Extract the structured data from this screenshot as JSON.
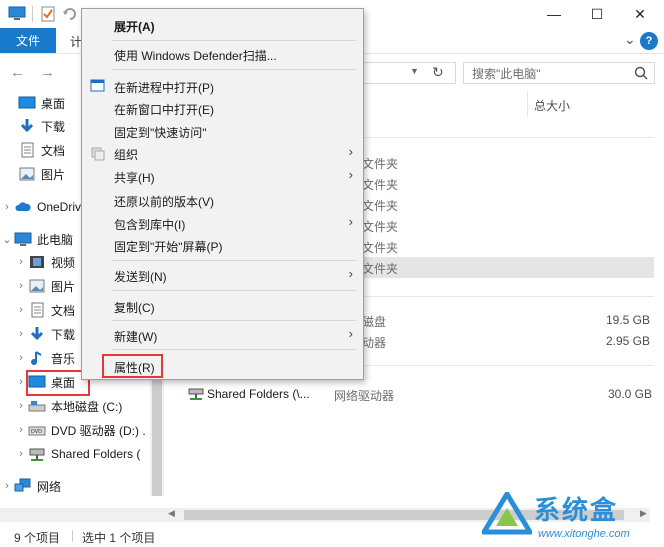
{
  "titlebar": {
    "minimize": "—",
    "maximize": "☐",
    "close": "✕"
  },
  "ribbon": {
    "file_tab": "文件",
    "tab_partial": "计",
    "expand": "⌄",
    "help": "?"
  },
  "address": {
    "search_placeholder": "搜索\"此电脑\""
  },
  "nav_pane": {
    "items": [
      {
        "label": "桌面",
        "icon": "desktop-icon"
      },
      {
        "label": "下载",
        "icon": "download-icon"
      },
      {
        "label": "文档",
        "icon": "document-icon"
      },
      {
        "label": "图片",
        "icon": "picture-icon"
      },
      {
        "label": "OneDrive",
        "icon": "cloud-icon"
      },
      {
        "label": "此电脑",
        "icon": "computer-icon"
      },
      {
        "label": "视频",
        "icon": "video-icon"
      },
      {
        "label": "图片",
        "icon": "picture-icon"
      },
      {
        "label": "文档",
        "icon": "document-icon"
      },
      {
        "label": "下载",
        "icon": "download-icon"
      },
      {
        "label": "音乐",
        "icon": "music-icon"
      },
      {
        "label": "桌面",
        "icon": "desktop-icon"
      },
      {
        "label": "本地磁盘 (C:)",
        "icon": "drive-icon"
      },
      {
        "label": "DVD 驱动器 (D:) .",
        "icon": "dvd-icon"
      },
      {
        "label": "Shared Folders (",
        "icon": "network-drive-icon"
      },
      {
        "label": "网络",
        "icon": "network-icon"
      }
    ]
  },
  "content": {
    "col_total_size": "总大小",
    "folder_type": "文件夹",
    "folder_rows": [
      "文件夹",
      "文件夹",
      "文件夹",
      "文件夹",
      "文件夹",
      "文件夹"
    ],
    "drives": [
      {
        "type_partial": "磁盘",
        "size": "19.5 GB"
      },
      {
        "type_partial": "动器",
        "size": "2.95 GB"
      }
    ],
    "shared": {
      "name": "Shared Folders (\\...",
      "type": "网络驱动器",
      "size": "30.0 GB"
    }
  },
  "context_menu": {
    "items": [
      {
        "label": "展开(A)",
        "bold": true
      },
      {
        "label": "使用 Windows Defender扫描..."
      },
      {
        "label": "在新进程中打开(P)"
      },
      {
        "label": "在新窗口中打开(E)"
      },
      {
        "label": "固定到\"快速访问\""
      },
      {
        "label": "组织"
      },
      {
        "label": "共享(H)"
      },
      {
        "label": "还原以前的版本(V)"
      },
      {
        "label": "包含到库中(I)"
      },
      {
        "label": "固定到\"开始\"屏幕(P)"
      },
      {
        "label": "发送到(N)"
      },
      {
        "label": "复制(C)"
      },
      {
        "label": "新建(W)"
      },
      {
        "label": "属性(R)"
      }
    ]
  },
  "statusbar": {
    "item_count": "9 个项目",
    "selected": "选中 1 个项目"
  },
  "watermark": {
    "text": "系统盒",
    "url": "www.xitonghe.com"
  },
  "colors": {
    "accent": "#1979ca",
    "highlight_box": "#e53935"
  }
}
